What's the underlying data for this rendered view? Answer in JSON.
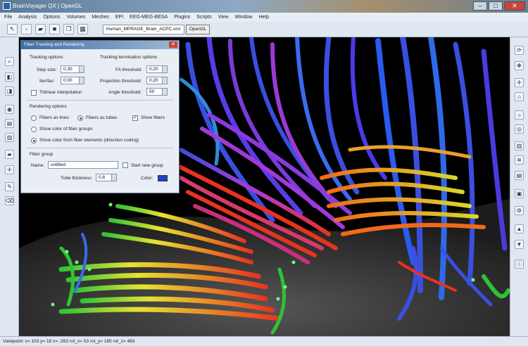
{
  "window": {
    "title": "BrainVoyager QX | OpenGL",
    "buttons": {
      "minimize": "–",
      "maximize": "□",
      "close": "✕"
    }
  },
  "menu": [
    "File",
    "Analysis",
    "Options",
    "Volumes",
    "Meshes",
    "EPI",
    "EEG-MEG-BESA",
    "Plugins",
    "Scripts",
    "View",
    "Window",
    "Help"
  ],
  "toolbar": {
    "document_tab": "Human_MPRAGE_Brain_ACPC.vmr",
    "open_button": "OpenGL"
  },
  "dialog": {
    "title": "Fiber Tracking and Rendering",
    "close": "✕",
    "tracking_options": {
      "heading": "Tracking options",
      "step_size_label": "Step size:",
      "step_size": "0,30",
      "iterations_label": "Iter/fac:",
      "iterations": "0,00",
      "trilinear_label": "Trilinear interpolation",
      "trilinear_checked": false
    },
    "termination": {
      "heading": "Tracking termination options",
      "fa_label": "FA threshold:",
      "fa": "0,20",
      "projection_label": "Projection threshold:",
      "projection": "0,20",
      "angle_label": "Angle threshold:",
      "angle": "50"
    },
    "rendering": {
      "heading": "Rendering options",
      "lines_label": "Fibers as lines",
      "tubes_label": "Fibers as tubes",
      "show_fibers_label": "Show fibers",
      "show_fibers_checked": true,
      "group_color_label": "Show color of fiber groups",
      "element_color_label": "Show color from fiber elements (direction coding)",
      "selected": "tubes+element"
    },
    "fiber_group": {
      "heading": "Fiber group",
      "name_label": "Name:",
      "name": "untitled",
      "start_new_label": "Start new group",
      "tube_thickness_label": "Tube thickness:",
      "tube_thickness": "0,8",
      "color_label": "Color:",
      "color": "#1d42c8"
    }
  },
  "status": {
    "text": "Viewpoint: x= 103 y= 18 z= -263 rot_x= 53 rot_y= 180 rot_z= 463"
  },
  "colors": {
    "accent": "#2c5aa0",
    "fiber_red": "#e8331e",
    "fiber_blue": "#3a4fe0",
    "fiber_green": "#2fc236"
  }
}
